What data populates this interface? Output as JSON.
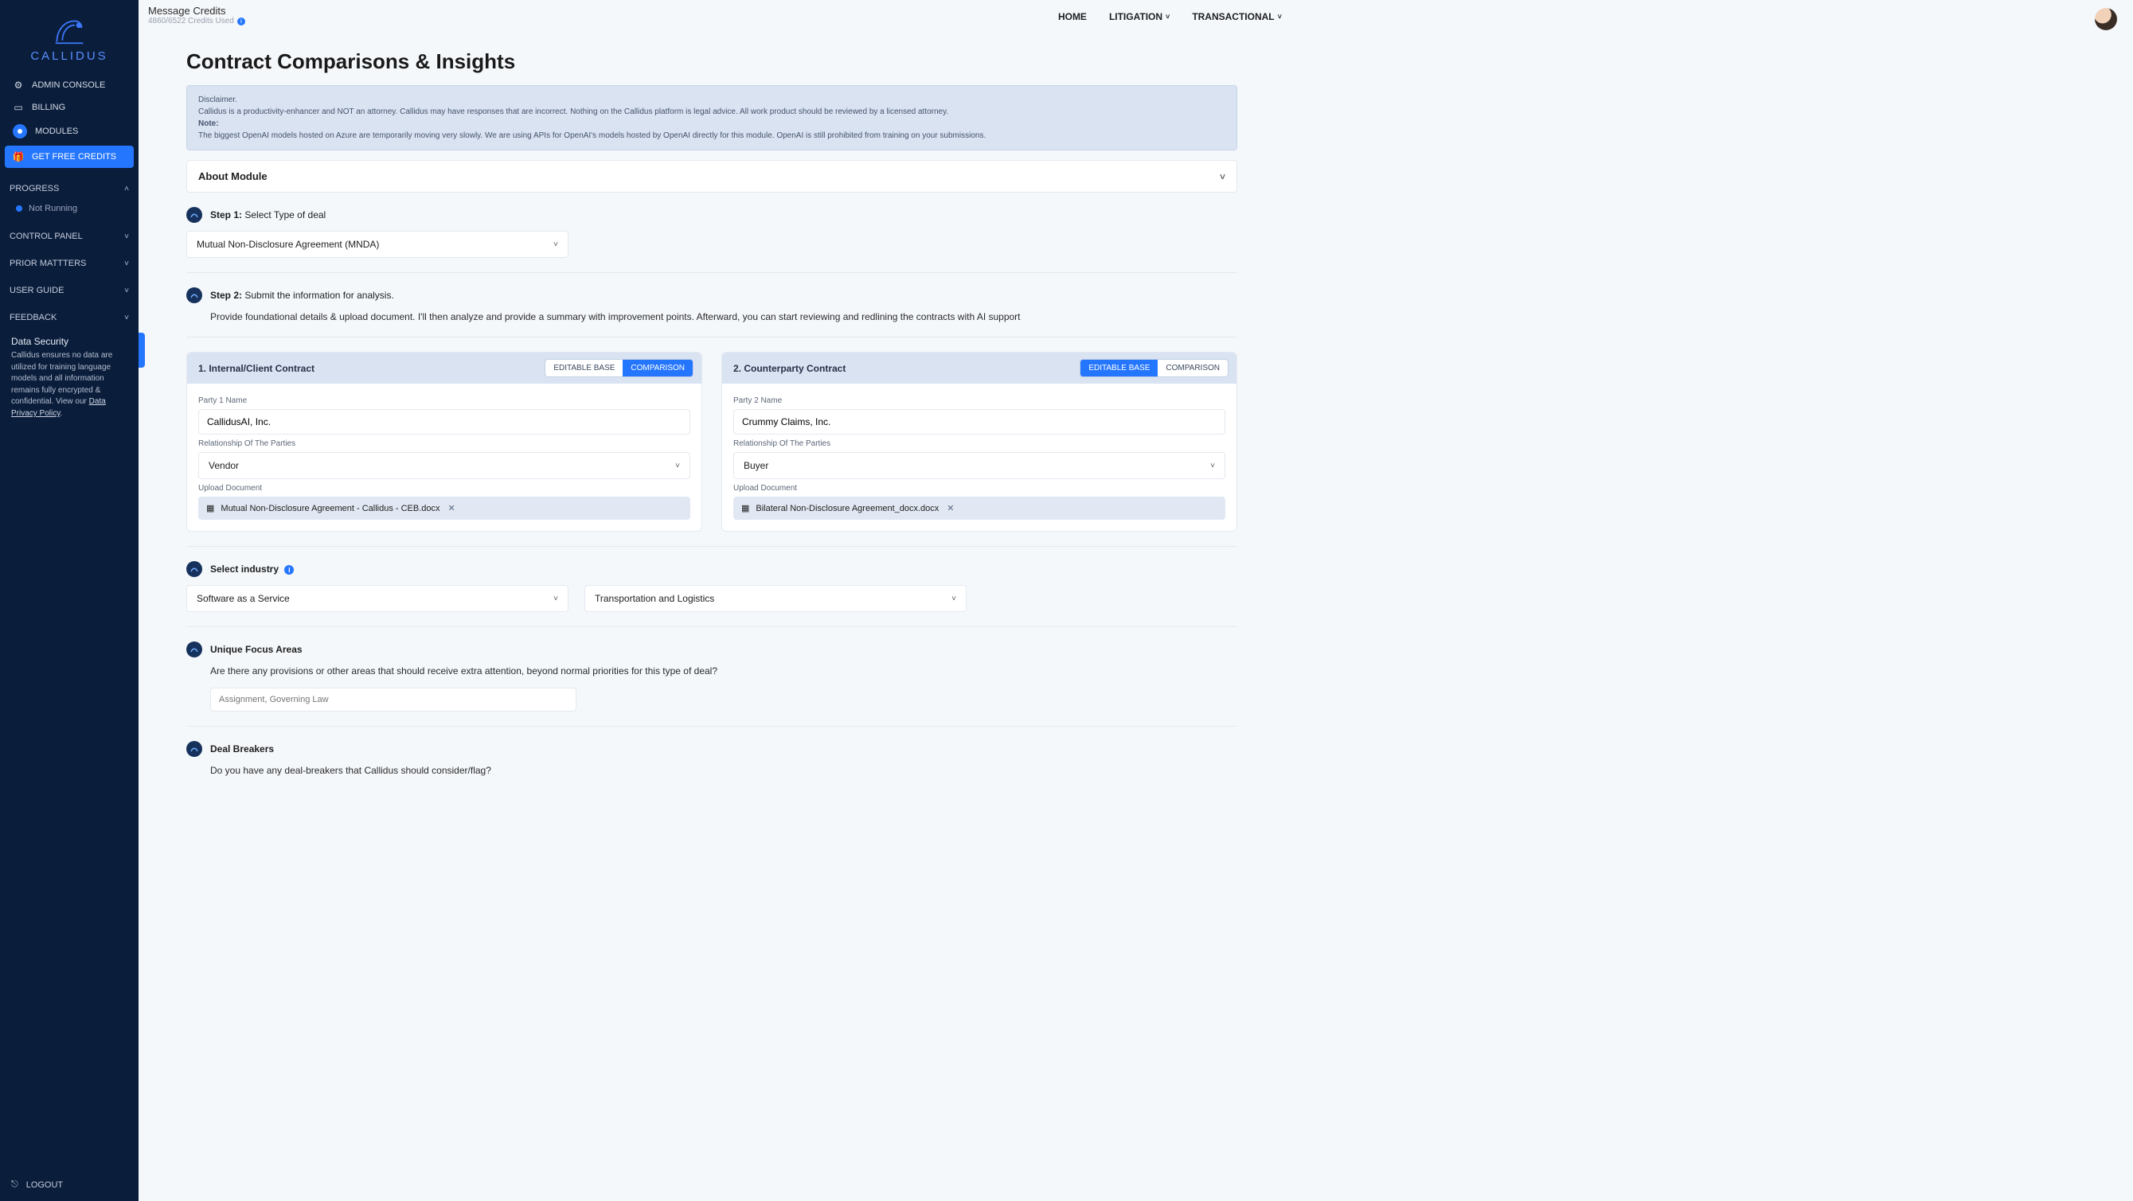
{
  "brand": "CALLIDUS",
  "header": {
    "credits_title": "Message Credits",
    "credits_sub": "4860/6522 Credits Used",
    "nav": [
      "HOME",
      "LITIGATION",
      "TRANSACTIONAL"
    ]
  },
  "sidebar": {
    "items": [
      {
        "label": "ADMIN CONSOLE",
        "icon": "gear"
      },
      {
        "label": "BILLING",
        "icon": "card"
      },
      {
        "label": "MODULES",
        "icon": "circle"
      },
      {
        "label": "GET FREE CREDITS",
        "icon": "gift",
        "highlight": true
      }
    ],
    "groups": [
      {
        "label": "PROGRESS",
        "open": true,
        "children": [
          {
            "label": "Not Running"
          }
        ]
      },
      {
        "label": "CONTROL PANEL",
        "open": false
      },
      {
        "label": "PRIOR MATTTERS",
        "open": false
      },
      {
        "label": "USER GUIDE",
        "open": false
      },
      {
        "label": "FEEDBACK",
        "open": false
      }
    ],
    "security": {
      "title": "Data Security",
      "body": "Callidus ensures no data are utilized for training language models and all information remains fully encrypted & confidential. View our ",
      "link": "Data Privacy Policy"
    },
    "logout": "LOGOUT"
  },
  "page": {
    "title": "Contract Comparisons & Insights",
    "notice": {
      "disclaimer_label": "Disclaimer.",
      "disclaimer_body": "Callidus is a productivity-enhancer and NOT an attorney. Callidus may have responses that are incorrect. Nothing on the Callidus platform is legal advice. All work product should be reviewed by a licensed attorney.",
      "note_label": "Note:",
      "note_body": "The biggest OpenAI models hosted on Azure are temporarily moving very slowly. We are using APIs for OpenAI's models hosted by OpenAI directly for this module. OpenAI is still prohibited from training on your submissions."
    },
    "about_module": "About Module",
    "step1": {
      "label": "Step 1:",
      "text": "Select Type of deal",
      "value": "Mutual Non-Disclosure Agreement (MNDA)"
    },
    "step2": {
      "label": "Step 2:",
      "text": "Submit the information for analysis.",
      "sub": "Provide foundational details & upload document. I'll then analyze and provide a summary with improvement points. Afterward, you can start reviewing and redlining the contracts with AI support"
    },
    "panel_labels": {
      "editable_base": "EDITABLE BASE",
      "comparison": "COMPARISON",
      "party1": "Party 1 Name",
      "party2": "Party 2 Name",
      "rel": "Relationship Of The Parties",
      "upload": "Upload Document"
    },
    "panel1": {
      "title": "1. Internal/Client Contract",
      "mode": "comparison",
      "party": "CallidusAI, Inc.",
      "relationship": "Vendor",
      "file": "Mutual Non-Disclosure Agreement - Callidus - CEB.docx"
    },
    "panel2": {
      "title": "2. Counterparty Contract",
      "mode": "editable",
      "party": "Crummy Claims, Inc.",
      "relationship": "Buyer",
      "file": "Bilateral Non-Disclosure Agreement_docx.docx"
    },
    "industry": {
      "label": "Select industry",
      "v1": "Software as a Service",
      "v2": "Transportation and Logistics"
    },
    "focus": {
      "title": "Unique Focus Areas",
      "q": "Are there any provisions or other areas that should receive extra attention, beyond normal priorities for this type of deal?",
      "ph": "Assignment, Governing Law"
    },
    "breakers": {
      "title": "Deal Breakers",
      "q": "Do you have any deal-breakers that Callidus should consider/flag?"
    }
  }
}
